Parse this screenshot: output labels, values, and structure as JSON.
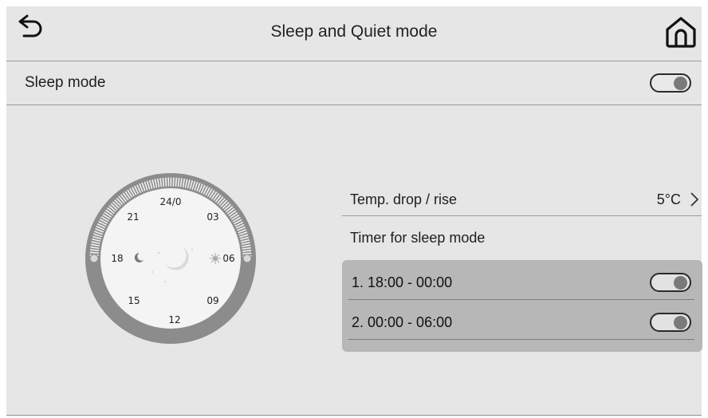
{
  "header": {
    "title": "Sleep and Quiet mode",
    "back_icon": "back-arrow-icon",
    "home_icon": "home-icon"
  },
  "sleep_mode": {
    "label": "Sleep mode",
    "toggle_state": "on"
  },
  "dial": {
    "hour_labels": [
      "24/0",
      "03",
      "06",
      "09",
      "12",
      "15",
      "18",
      "21"
    ],
    "night_icon": "moon-icon",
    "day_icon": "sun-icon"
  },
  "temp": {
    "label": "Temp. drop / rise",
    "value": "5°C",
    "chevron_icon": "chevron-right-icon"
  },
  "timer": {
    "title": "Timer for sleep mode",
    "items": [
      {
        "label": "1. 18:00 - 00:00",
        "toggle_state": "on"
      },
      {
        "label": "2. 00:00 - 06:00",
        "toggle_state": "on"
      }
    ]
  },
  "colors": {
    "background": "#e6e6e6",
    "panel": "#b7b7b7",
    "dial_ring": "#8c8c8c",
    "divider": "#9a9a9a"
  }
}
